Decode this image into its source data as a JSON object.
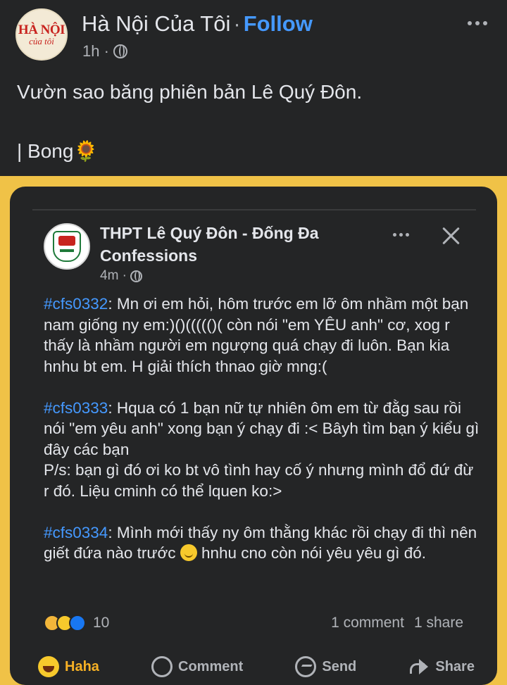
{
  "outer_post": {
    "page_name": "Hà Nội Của Tôi",
    "separator": "·",
    "follow_label": "Follow",
    "time": "1h ·",
    "avatar_logo_top": "HÀ NỘI",
    "avatar_logo_bottom": "của tôi",
    "caption_line1": "Vườn sao băng phiên bản Lê Quý Đôn.",
    "caption_line2": "| Bong🌻"
  },
  "shared_post": {
    "group_name": "THPT Lê Quý Đôn - Đống Đa Confessions",
    "time": "4m ·",
    "confessions": [
      {
        "tag": "#cfs0332",
        "text": ": Mn ơi em hỏi, hôm trước em lỡ ôm nhầm một bạn nam giống ny em:)()((((()( còn nói \"em YÊU anh\" cơ, xog r thấy là nhầm người em ngượng quá chạy đi luôn. Bạn kia hnhu bt em. H giải thích thnao giờ mng:("
      },
      {
        "tag": "#cfs0333",
        "text": ": Hqua có 1 bạn nữ tự nhiên ôm em từ đằg sau rồi nói \"em yêu anh\" xong bạn ý chạy đi :< Bâyh tìm bạn ý kiểu gì đây các bạn",
        "ps": "P/s: bạn gì đó ơi ko bt vô tình hay cố ý nhưng mình đổ đứ đừ r đó. Liệu cminh có thể lquen ko:>"
      },
      {
        "tag": "#cfs0334",
        "text_before": ": Mình mới thấy ny ôm thằng khác rồi chạy đi thì nên giết đứa nào trước ",
        "text_after": " hnhu cno còn nói yêu yêu gì đó."
      }
    ],
    "reaction_count": "10",
    "comments": "1 comment",
    "shares": "1 share",
    "actions": {
      "haha": "Haha",
      "comment": "Comment",
      "send": "Send",
      "share": "Share"
    }
  },
  "colors": {
    "background": "#242526",
    "link_blue": "#4599ff",
    "haha_active": "#f7b125",
    "photo_yellow": "#f0c247"
  }
}
